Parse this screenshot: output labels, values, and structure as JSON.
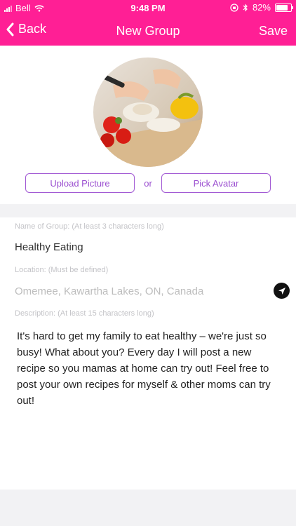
{
  "status_bar": {
    "carrier": "Bell",
    "time": "9:48 PM",
    "battery_percent": "82%",
    "battery_level": 0.82
  },
  "nav": {
    "back_label": "Back",
    "title": "New Group",
    "save_label": "Save"
  },
  "avatar_section": {
    "upload_button_label": "Upload Picture",
    "or_label": "or",
    "pick_avatar_button_label": "Pick Avatar"
  },
  "form": {
    "name_label": "Name of Group: (At least 3 characters long)",
    "name_value": "Healthy Eating",
    "location_label": "Location: (Must be defined)",
    "location_placeholder": "Omemee, Kawartha Lakes, ON, Canada",
    "description_label": "Description: (At least 15 characters long)",
    "description_value": "It's hard to get my family to eat healthy – we're just so busy! What about you? Every day I will post a new recipe so you mamas at home can try out! Feel free to post your own recipes for myself & other moms can try out!"
  },
  "colors": {
    "brand_pink": "#ff1f95",
    "button_purple": "#9b4fd0"
  }
}
